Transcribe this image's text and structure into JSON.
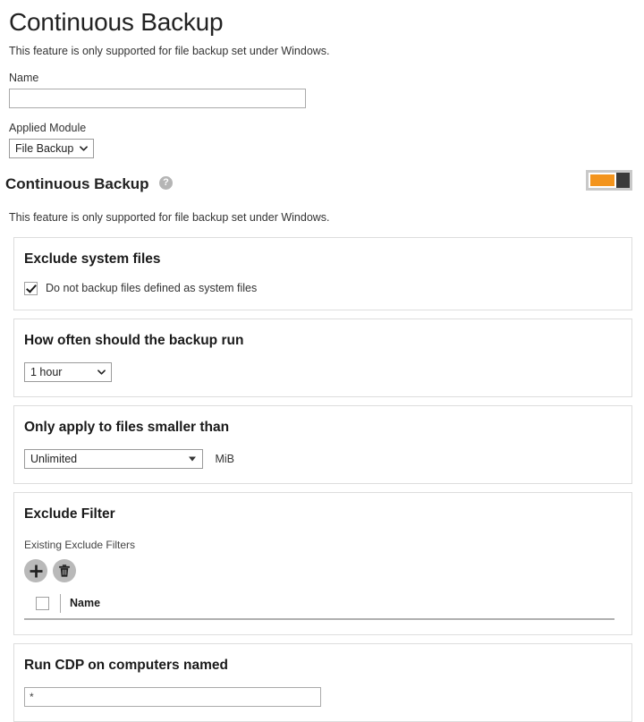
{
  "header": {
    "title": "Continuous Backup",
    "note": "This feature is only supported for file backup set under Windows."
  },
  "name_field": {
    "label": "Name",
    "value": "",
    "placeholder": ""
  },
  "applied_module": {
    "label": "Applied Module",
    "selected": "File Backup",
    "options": [
      "File Backup"
    ],
    "chevron_icon": "chevron-down-icon"
  },
  "continuous_backup": {
    "title": "Continuous Backup",
    "help_icon": "help-icon",
    "help_glyph": "?",
    "note": "This feature is only supported for file backup set under Windows.",
    "toggle": {
      "state": "on",
      "on_color": "#f3941d",
      "knob_color": "#3a3a3a",
      "frame_color": "#c9c9c9"
    }
  },
  "sections": {
    "exclude_system_files": {
      "title": "Exclude system files",
      "checkbox_label": "Do not backup files defined as system files",
      "checked": true
    },
    "frequency": {
      "title": "How often should the backup run",
      "selected": "1 hour",
      "options": [
        "1 hour"
      ],
      "chevron_icon": "chevron-down-icon"
    },
    "file_size_limit": {
      "title": "Only apply to files smaller than",
      "selected": "Unlimited",
      "options": [
        "Unlimited"
      ],
      "unit": "MiB",
      "arrow_icon": "triangle-down-icon"
    },
    "exclude_filter": {
      "title": "Exclude Filter",
      "sub_label": "Existing Exclude Filters",
      "add_icon": "plus-icon",
      "delete_icon": "trash-icon",
      "table": {
        "select_all_checked": false,
        "columns": [
          "Name"
        ],
        "rows": []
      }
    },
    "run_cdp": {
      "title": "Run CDP on computers named",
      "value": "*",
      "placeholder": ""
    }
  }
}
